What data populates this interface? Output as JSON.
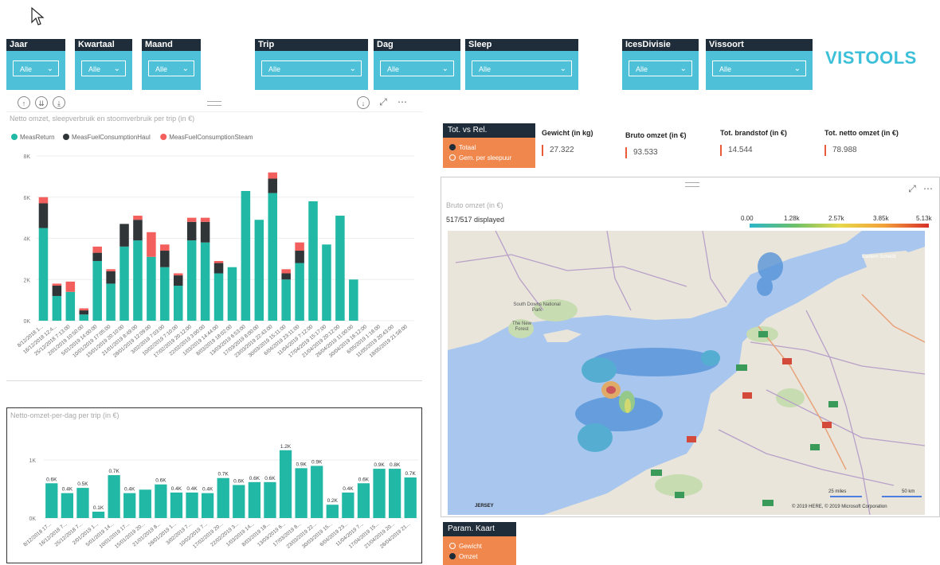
{
  "slicers": [
    {
      "label": "Jaar",
      "value": "Alle"
    },
    {
      "label": "Kwartaal",
      "value": "Alle"
    },
    {
      "label": "Maand",
      "value": "Alle"
    },
    {
      "label": "Trip",
      "value": "Alle"
    },
    {
      "label": "Dag",
      "value": "Alle"
    },
    {
      "label": "Sleep",
      "value": "Alle"
    },
    {
      "label": "IcesDivisie",
      "value": "Alle"
    },
    {
      "label": "Vissoort",
      "value": "Alle"
    }
  ],
  "brand": {
    "logo": "VISTOOLS",
    "accent": "#4ec1d9",
    "dark": "#1f2d3a",
    "orange": "#f0884d"
  },
  "chart1": {
    "title": "Netto omzet, sleepverbruik en stoomverbruik per trip (in €)",
    "legend": [
      "MeasReturn",
      "MeasFuelConsumptionHaul",
      "MeasFuelConsumptionSteam"
    ]
  },
  "chart2": {
    "title": "Netto-omzet-per-dag per trip (in €)"
  },
  "tot_vs_rel": {
    "title": "Tot. vs Rel.",
    "options": [
      "Totaal",
      "Gem. per sleepuur"
    ],
    "selected": 0
  },
  "kpis": [
    {
      "label": "Gewicht (in kg)",
      "value": "27.322"
    },
    {
      "label": "Bruto omzet (in €)",
      "value": "93.533"
    },
    {
      "label": "Tot. brandstof (in €)",
      "value": "14.544"
    },
    {
      "label": "Tot. netto omzet (in €)",
      "value": "78.988"
    }
  ],
  "map": {
    "title": "Bruto omzet (in €)",
    "displayed": "517/517 displayed",
    "legend_ticks": [
      "0.00",
      "1.28k",
      "2.57k",
      "3.85k",
      "5.13k"
    ],
    "places": [
      "South Downs National Park",
      "The New Forest",
      "Eastern Scheldt",
      "JERSEY"
    ],
    "attribution": "© 2019 HERE, © 2019 Microsoft Corporation",
    "scale": [
      "25 miles",
      "50 km"
    ]
  },
  "param_kaart": {
    "title": "Param. Kaart",
    "options": [
      "Gewicht",
      "Omzet"
    ],
    "selected": 1
  },
  "chart_data": [
    {
      "type": "bar",
      "stacked": true,
      "title": "Netto omzet, sleepverbruik en stoomverbruik per trip (in €)",
      "yticks": [
        "0K",
        "2K",
        "4K",
        "6K",
        "8K"
      ],
      "ylim": [
        0,
        8000
      ],
      "categories": [
        "8/12/2018 1...",
        "16/12/2018 12:4...",
        "25/12/2018 7:13:00",
        "2/01/2019 10:50:00",
        "5/01/2019 14:00:00",
        "10/01/2019 17:05:00",
        "15/01/2019 20:10:00",
        "21/01/2019 8:49:00",
        "28/01/2019 12:09:00",
        "3/02/2019 7:03:00",
        "10/02/2019 7:10:00",
        "17/02/2019 20:12:00",
        "22/02/2019 3:00:00",
        "1/03/2019 14:44:00",
        "8/03/2019 18:02:00",
        "13/03/2019 6:53:00",
        "17/03/2019 8:00:00",
        "23/03/2019 22:43:00",
        "30/03/2019 15:11:00",
        "6/04/2019 23:11:00",
        "11/04/2019 7:12:00",
        "17/04/2019 15:17:00",
        "21/04/2019 20:12:00",
        "26/04/2019 11:00:00",
        "30/04/2019 16:12:00",
        "6/05/2019 1:16:00",
        "11/05/2019 20:43:00",
        "18/05/2019 21:58:00"
      ],
      "series": [
        {
          "name": "MeasReturn",
          "color": "#21b8a6",
          "values": [
            4500,
            1200,
            1400,
            300,
            2900,
            1800,
            3600,
            3900,
            3100,
            2600,
            1700,
            3900,
            3800,
            2300,
            2600,
            6300,
            4900,
            6200,
            2000,
            2800,
            5800,
            3700,
            5100,
            2000,
            0,
            0,
            0,
            0
          ]
        },
        {
          "name": "MeasFuelConsumptionHaul",
          "color": "#303537",
          "values": [
            1200,
            500,
            0,
            200,
            400,
            600,
            1100,
            1000,
            0,
            800,
            500,
            900,
            1000,
            500,
            0,
            0,
            0,
            700,
            300,
            600,
            0,
            0,
            0,
            0,
            0,
            0,
            0,
            0
          ]
        },
        {
          "name": "MeasFuelConsumptionSteam",
          "color": "#f25f5c",
          "values": [
            300,
            100,
            500,
            100,
            300,
            100,
            0,
            200,
            1200,
            300,
            100,
            200,
            200,
            100,
            0,
            0,
            0,
            300,
            200,
            400,
            0,
            0,
            0,
            0,
            0,
            0,
            0,
            0
          ]
        }
      ]
    },
    {
      "type": "bar",
      "title": "Netto-omzet-per-dag per trip (in €)",
      "yticks": [
        "0K",
        "1K"
      ],
      "ylim": [
        0,
        1400
      ],
      "values": [
        600,
        430,
        520,
        110,
        740,
        430,
        490,
        580,
        440,
        440,
        430,
        690,
        570,
        620,
        620,
        1170,
        860,
        900,
        230,
        440,
        600,
        850,
        850,
        700
      ],
      "labels": [
        "0.6K",
        "0.4K",
        "0.5K",
        "0.1K",
        "0.7K",
        "0.4K",
        "",
        "0.6K",
        "0.4K",
        "0.4K",
        "0.4K",
        "0.7K",
        "0.6K",
        "0.6K",
        "0.6K",
        "1.2K",
        "0.9K",
        "0.9K",
        "0.2K",
        "0.4K",
        "0.6K",
        "0.9K",
        "0.8K",
        "0.7K"
      ],
      "categories": [
        "8/12/2018 17...",
        "16/12/2018 7...",
        "25/12/2018 7...",
        "2/01/2019 1...",
        "5/01/2019 14...",
        "10/01/2019 17...",
        "15/01/2019 20...",
        "21/01/2019 8...",
        "28/01/2019 1...",
        "3/02/2019 7...",
        "10/02/2019 7...",
        "17/02/2019 20...",
        "22/02/2019 3...",
        "1/03/2019 14...",
        "8/03/2019 18...",
        "13/03/2019 6...",
        "17/03/2019 8...",
        "23/03/2019 22...",
        "30/03/2019 15...",
        "6/04/2019 23...",
        "11/04/2019 7...",
        "17/04/2019 15...",
        "21/04/2019 20...",
        "26/04/2019 21..."
      ]
    }
  ]
}
